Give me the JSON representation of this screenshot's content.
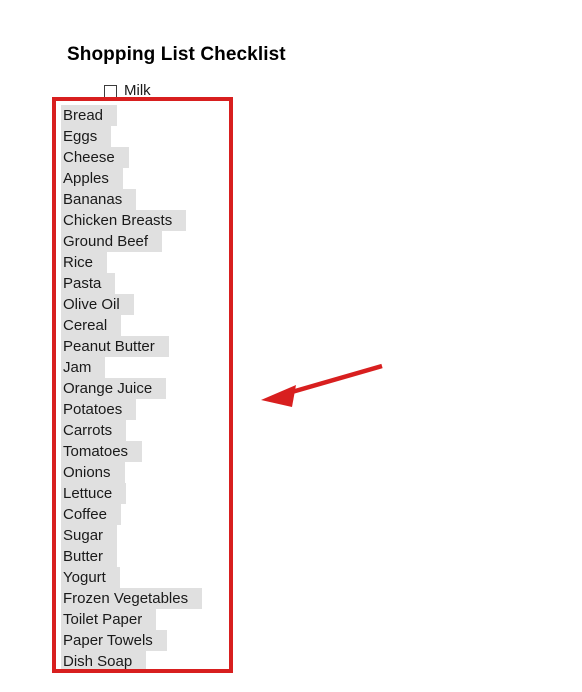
{
  "page": {
    "title": "Shopping List Checklist",
    "background_color": "#ffffff"
  },
  "checklist": {
    "first_row": {
      "checkbox_icon": "checkbox-unchecked-icon",
      "checked": false,
      "label": "Milk"
    },
    "highlight_color": "#e0e0e0",
    "items": [
      "Bread",
      "Eggs",
      "Cheese",
      "Apples",
      "Bananas",
      "Chicken Breasts",
      "Ground Beef",
      "Rice",
      "Pasta",
      "Olive Oil",
      "Cereal",
      "Peanut Butter",
      "Jam",
      "Orange Juice",
      "Potatoes",
      "Carrots",
      "Tomatoes",
      "Onions",
      "Lettuce",
      "Coffee",
      "Sugar",
      "Butter",
      "Yogurt",
      "Frozen Vegetables",
      "Toilet Paper",
      "Paper Towels",
      "Dish Soap"
    ]
  },
  "annotations": {
    "box": {
      "icon": "rectangle-outline-icon",
      "color": "#d81f1f"
    },
    "arrow": {
      "icon": "arrow-left-icon",
      "color": "#d81f1f",
      "direction": "points-left-down-to-list"
    }
  }
}
